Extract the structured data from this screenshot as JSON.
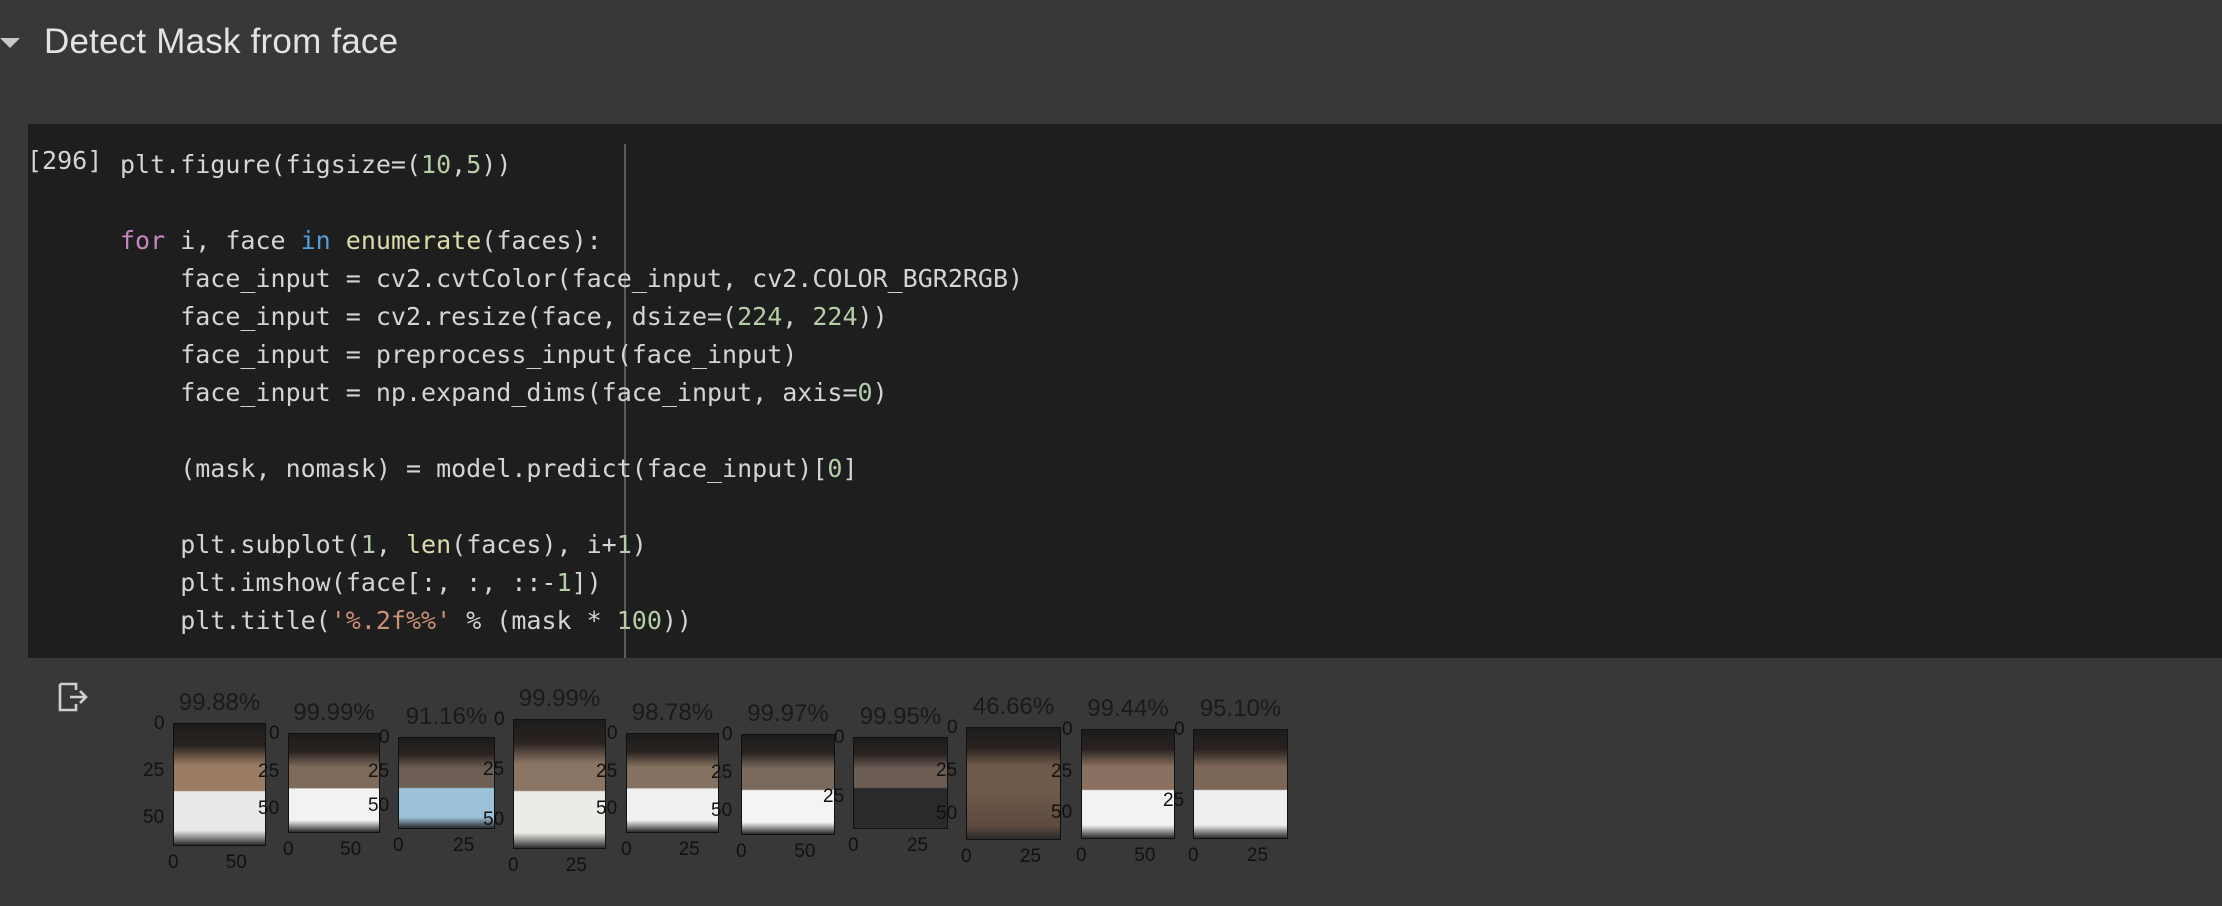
{
  "section": {
    "title": "Detect Mask from face"
  },
  "cell": {
    "execution_count": "[296]",
    "code_lines": [
      "plt.figure(figsize=(10,5))",
      "",
      "for i, face in enumerate(faces):",
      "    face_input = cv2.cvtColor(face_input, cv2.COLOR_BGR2RGB)",
      "    face_input = cv2.resize(face, dsize=(224, 224))",
      "    face_input = preprocess_input(face_input)",
      "    face_input = np.expand_dims(face_input, axis=0)",
      "",
      "    (mask, nomask) = model.predict(face_input)[0]",
      "",
      "    plt.subplot(1, len(faces), i+1)",
      "    plt.imshow(face[:, :, ::-1])",
      "    plt.title('%.2f%%' % (mask * 100))"
    ]
  },
  "output": {
    "icon": "output-redirect-icon",
    "subplots": [
      {
        "title": "99.88%",
        "yticks": [
          "0",
          "25",
          "50"
        ],
        "xticks": [
          "0",
          "50"
        ]
      },
      {
        "title": "99.99%",
        "yticks": [
          "0",
          "25",
          "50"
        ],
        "xticks": [
          "0",
          "50"
        ]
      },
      {
        "title": "91.16%",
        "yticks": [
          "0",
          "25",
          "50"
        ],
        "xticks": [
          "0",
          "25"
        ]
      },
      {
        "title": "99.99%",
        "yticks": [
          "0",
          "25",
          "50"
        ],
        "xticks": [
          "0",
          "25"
        ]
      },
      {
        "title": "98.78%",
        "yticks": [
          "0",
          "25",
          "50"
        ],
        "xticks": [
          "0",
          "25"
        ]
      },
      {
        "title": "99.97%",
        "yticks": [
          "0",
          "25",
          "50"
        ],
        "xticks": [
          "0",
          "50"
        ]
      },
      {
        "title": "99.95%",
        "yticks": [
          "0",
          "25"
        ],
        "xticks": [
          "0",
          "25"
        ]
      },
      {
        "title": "46.66%",
        "yticks": [
          "0",
          "25",
          "50"
        ],
        "xticks": [
          "0",
          "25"
        ]
      },
      {
        "title": "99.44%",
        "yticks": [
          "0",
          "25",
          "50"
        ],
        "xticks": [
          "0",
          "50"
        ]
      },
      {
        "title": "95.10%",
        "yticks": [
          "0",
          "25"
        ],
        "xticks": [
          "0",
          "25"
        ]
      }
    ]
  },
  "colors": {
    "background": "#383838",
    "code_bg": "#1e1e1e",
    "keyword": "#c586c0",
    "number": "#b5cea8",
    "string": "#ce9178",
    "function": "#dcdcaa"
  }
}
